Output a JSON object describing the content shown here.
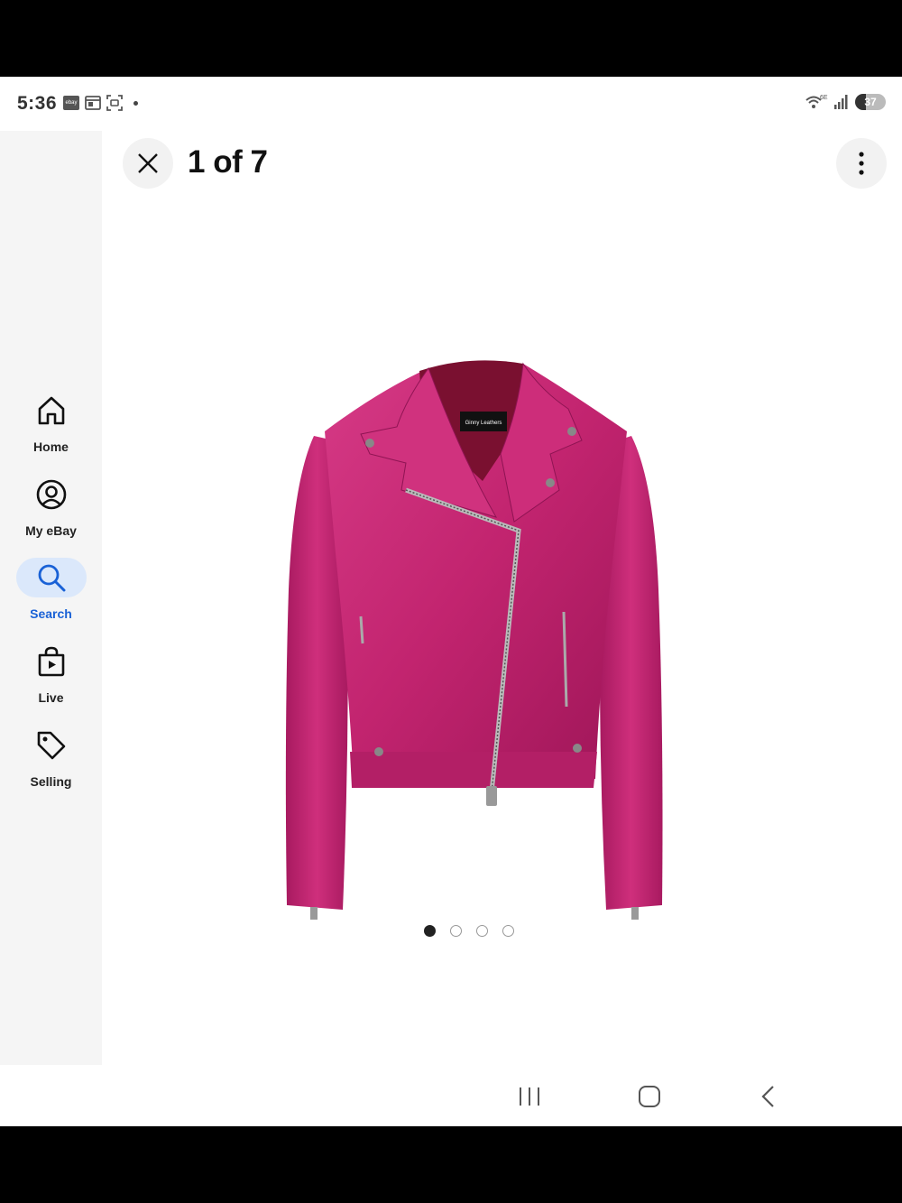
{
  "status_bar": {
    "time": "5:36",
    "ebay_badge": "ebay",
    "network": "6E",
    "battery": "37"
  },
  "header": {
    "title": "1 of 7"
  },
  "side_nav": {
    "items": [
      {
        "label": "Home",
        "icon": "home-icon"
      },
      {
        "label": "My eBay",
        "icon": "account-icon"
      },
      {
        "label": "Search",
        "icon": "search-icon",
        "active": true
      },
      {
        "label": "Live",
        "icon": "live-bag-icon"
      },
      {
        "label": "Selling",
        "icon": "tag-icon"
      }
    ]
  },
  "product": {
    "image": "pink-leather-moto-jacket",
    "label_text": "Ginny Leathers",
    "active_slide": 1,
    "visible_dots": 4
  },
  "colors": {
    "accent": "#1961d6",
    "active_pill": "#dbe8fb",
    "jacket": "#c2246f"
  }
}
